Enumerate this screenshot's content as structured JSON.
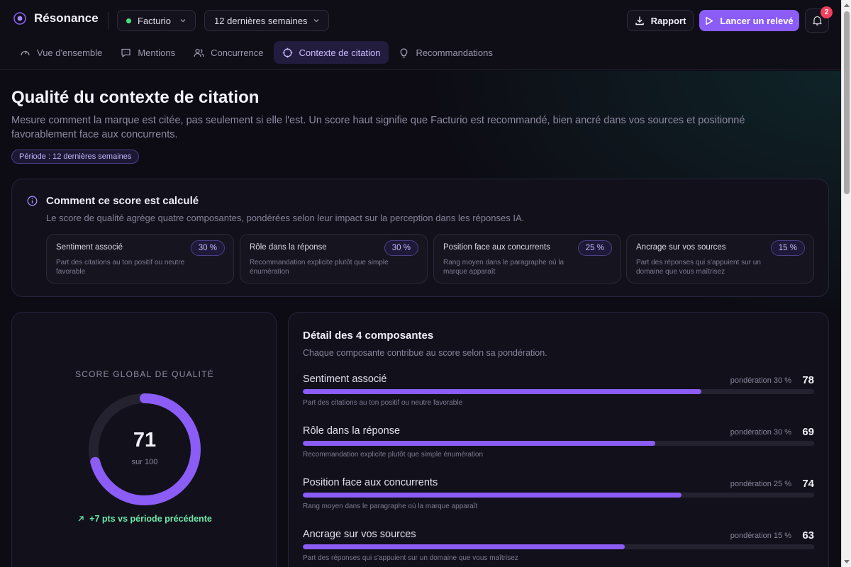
{
  "app": {
    "name": "Résonance"
  },
  "header": {
    "project": "Facturio",
    "period": "12 dernières semaines",
    "report_label": "Rapport",
    "launch_label": "Lancer un relevé",
    "notifications_count": "2"
  },
  "tabs": [
    {
      "label": "Vue d'ensemble",
      "icon": "gauge-icon",
      "active": false
    },
    {
      "label": "Mentions",
      "icon": "message-icon",
      "active": false
    },
    {
      "label": "Concurrence",
      "icon": "users-icon",
      "active": false
    },
    {
      "label": "Contexte de citation",
      "icon": "target-icon",
      "active": true
    },
    {
      "label": "Recommandations",
      "icon": "lightbulb-icon",
      "active": false
    }
  ],
  "page": {
    "title": "Qualité du contexte de citation",
    "description": "Mesure comment la marque est citée, pas seulement si elle l'est. Un score haut signifie que Facturio est recommandé, bien ancré dans vos sources et positionné favorablement face aux concurrents.",
    "period_chip": "Période : 12 dernières semaines"
  },
  "how": {
    "title": "Comment ce score est calculé",
    "description": "Le score de qualité agrège quatre composantes, pondérées selon leur impact sur la perception dans les réponses IA.",
    "components": [
      {
        "name": "Sentiment associé",
        "weight": "30 %",
        "description": "Part des citations au ton positif ou neutre favorable"
      },
      {
        "name": "Rôle dans la réponse",
        "weight": "30 %",
        "description": "Recommandation explicite plutôt que simple énumération"
      },
      {
        "name": "Position face aux concurrents",
        "weight": "25 %",
        "description": "Rang moyen dans le paragraphe où la marque apparaît"
      },
      {
        "name": "Ancrage sur vos sources",
        "weight": "15 %",
        "description": "Part des réponses qui s'appuient sur un domaine que vous maîtrisez"
      }
    ]
  },
  "score": {
    "label": "SCORE GLOBAL DE QUALITÉ",
    "value": 71,
    "value_text": "71",
    "max_text": "sur 100",
    "delta": "+7 pts vs période précédente",
    "accent": "#8b5cf6",
    "track_color": "#24222f"
  },
  "detail": {
    "title": "Détail des 4 composantes",
    "description": "Chaque composante contribue au score selon sa pondération.",
    "components": [
      {
        "name": "Sentiment associé",
        "weight": "pondération 30 %",
        "score": 78,
        "score_text": "78",
        "description": "Part des citations au ton positif ou neutre favorable"
      },
      {
        "name": "Rôle dans la réponse",
        "weight": "pondération 30 %",
        "score": 69,
        "score_text": "69",
        "description": "Recommandation explicite plutôt que simple énumération"
      },
      {
        "name": "Position face aux concurrents",
        "weight": "pondération 25 %",
        "score": 74,
        "score_text": "74",
        "description": "Rang moyen dans le paragraphe où la marque apparaît"
      },
      {
        "name": "Ancrage sur vos sources",
        "weight": "pondération 15 %",
        "score": 63,
        "score_text": "63",
        "description": "Part des réponses qui s'appuient sur un domaine que vous maîtrisez"
      }
    ]
  }
}
